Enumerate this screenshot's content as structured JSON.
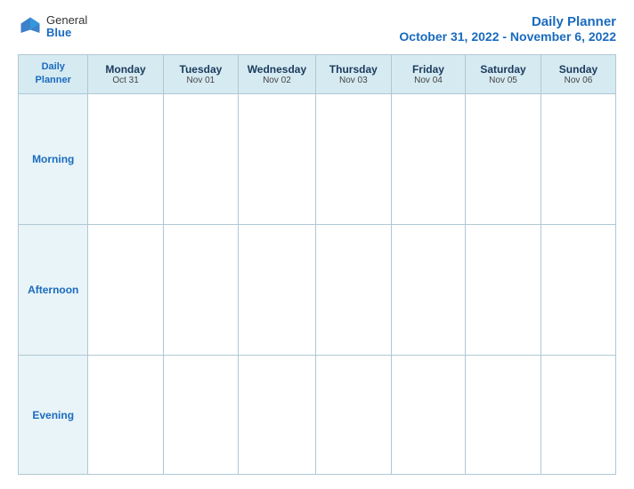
{
  "header": {
    "logo_general": "General",
    "logo_blue": "Blue",
    "title": "Daily Planner",
    "date_range": "October 31, 2022 - November 6, 2022"
  },
  "columns": [
    {
      "id": "label",
      "day": "Daily",
      "day2": "Planner",
      "date": ""
    },
    {
      "id": "mon",
      "day": "Monday",
      "date": "Oct 31"
    },
    {
      "id": "tue",
      "day": "Tuesday",
      "date": "Nov 01"
    },
    {
      "id": "wed",
      "day": "Wednesday",
      "date": "Nov 02"
    },
    {
      "id": "thu",
      "day": "Thursday",
      "date": "Nov 03"
    },
    {
      "id": "fri",
      "day": "Friday",
      "date": "Nov 04"
    },
    {
      "id": "sat",
      "day": "Saturday",
      "date": "Nov 05"
    },
    {
      "id": "sun",
      "day": "Sunday",
      "date": "Nov 06"
    }
  ],
  "rows": [
    {
      "id": "morning",
      "label": "Morning"
    },
    {
      "id": "afternoon",
      "label": "Afternoon"
    },
    {
      "id": "evening",
      "label": "Evening"
    }
  ]
}
